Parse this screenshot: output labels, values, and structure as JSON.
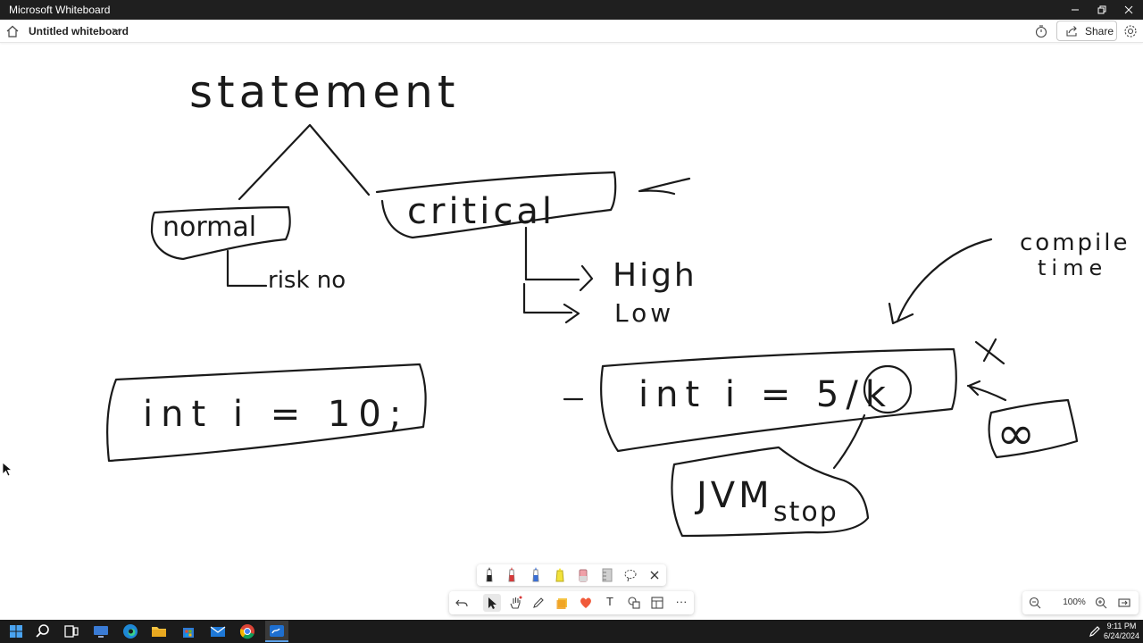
{
  "window": {
    "title": "Microsoft Whiteboard",
    "controls": [
      "minimize",
      "restore",
      "close"
    ]
  },
  "appbar": {
    "board_name": "Untitled whiteboard",
    "share_label": "Share"
  },
  "canvas": {
    "ink_text": {
      "statement": "statement",
      "normal": "normal",
      "critical": "critical",
      "risk_no": "risk no",
      "high": "High",
      "low": "Low",
      "int_i_10": "int i = 10;",
      "int_i_div_k": "int i = 5/k",
      "k": "k",
      "jvm": "JVM",
      "stop": "stop",
      "compile": "compile",
      "time": "time",
      "cross": "X",
      "infinity": "∞"
    }
  },
  "pen_tray": {
    "pens": [
      {
        "name": "black-pen-icon",
        "color": "#222222"
      },
      {
        "name": "red-pen-icon",
        "color": "#d63a3a"
      },
      {
        "name": "blue-pen-icon",
        "color": "#3a6fd6"
      },
      {
        "name": "highlighter-icon",
        "color": "#f2e23a"
      },
      {
        "name": "eraser-icon",
        "color": "#f0a0a8"
      },
      {
        "name": "ruler-icon",
        "color": "#bdbdbd"
      }
    ]
  },
  "toolbar": {
    "tools": [
      "undo-icon",
      "select-icon",
      "hand-icon",
      "pen-icon",
      "sticky-note-icon",
      "reactions-icon",
      "text-icon",
      "shapes-icon",
      "templates-icon",
      "more-icon"
    ],
    "text_tool_label": "T",
    "more_label": "···"
  },
  "zoom": {
    "level": "100%"
  },
  "taskbar": {
    "time": "9:11 PM",
    "date": "6/24/2024"
  },
  "colors": {
    "titlebar": "#1f1f1f",
    "taskbar": "#1b1b1b",
    "ink": "#1a1a1a",
    "accent": "#5ba0e8"
  }
}
